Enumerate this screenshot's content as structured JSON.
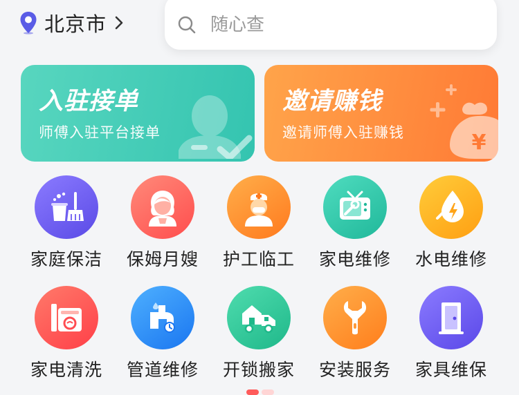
{
  "location": {
    "city": "北京市",
    "icon": "location-pin-icon",
    "chevron_icon": "chevron-right-icon"
  },
  "search": {
    "placeholder": "随心查",
    "icon": "search-icon"
  },
  "banners": [
    {
      "title": "入驻接单",
      "subtitle": "师傅入驻平台接单",
      "icon": "user-check-icon"
    },
    {
      "title": "邀请赚钱",
      "subtitle": "邀请师傅入驻赚钱",
      "icon": "money-bag-icon"
    }
  ],
  "services": [
    {
      "label": "家庭保洁",
      "icon": "cleaning-broom-icon"
    },
    {
      "label": "保姆月嫂",
      "icon": "nanny-icon"
    },
    {
      "label": "护工临工",
      "icon": "nurse-icon"
    },
    {
      "label": "家电维修",
      "icon": "appliance-repair-icon"
    },
    {
      "label": "水电维修",
      "icon": "water-electric-icon"
    },
    {
      "label": "家电清洗",
      "icon": "appliance-cleaning-icon"
    },
    {
      "label": "管道维修",
      "icon": "pipe-repair-icon"
    },
    {
      "label": "开锁搬家",
      "icon": "moving-truck-icon"
    },
    {
      "label": "安装服务",
      "icon": "wrench-icon"
    },
    {
      "label": "家具维保",
      "icon": "door-icon"
    }
  ],
  "colors": {
    "accent": "#5a5ce6",
    "banner_left": "#3cc9b4",
    "banner_right": "#ff8a3c",
    "services": [
      "#6f5ef0",
      "#ff5a5a",
      "#ff8c2e",
      "#2ec8a8",
      "#ffab1f",
      "#ff5151",
      "#2a8cff",
      "#2ec8a0",
      "#ff8a25",
      "#6a58ee"
    ]
  }
}
